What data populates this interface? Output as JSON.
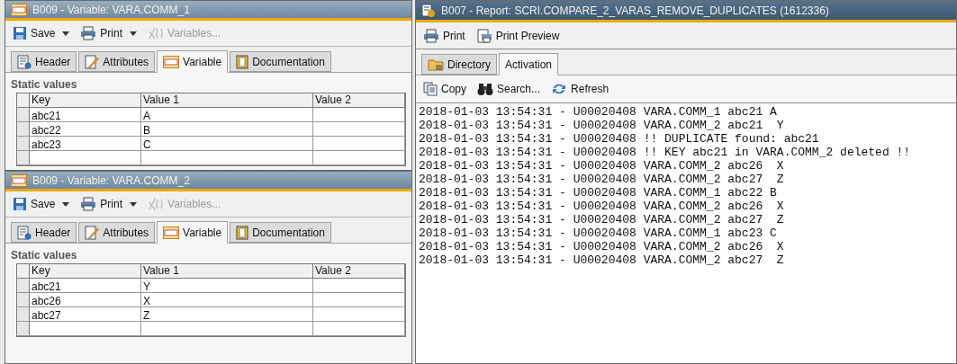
{
  "variable_windows": [
    {
      "title": "B009 - Variable: VARA.COMM_1",
      "toolbar": [
        {
          "label": "Save",
          "dropdown": true,
          "disabled": false
        },
        {
          "label": "Print",
          "dropdown": true,
          "disabled": false
        },
        {
          "label": "Variables...",
          "dropdown": false,
          "disabled": true
        }
      ],
      "tabs": [
        {
          "label": "Header",
          "selected": false
        },
        {
          "label": "Attributes",
          "selected": false
        },
        {
          "label": "Variable",
          "selected": true
        },
        {
          "label": "Documentation",
          "selected": false
        }
      ],
      "group_title": "Static values",
      "table": {
        "columns": [
          "Key",
          "Value 1",
          "Value 2"
        ],
        "rows": [
          [
            "abc21",
            "A"
          ],
          [
            "abc22",
            "B"
          ],
          [
            "abc23",
            "C"
          ]
        ]
      }
    },
    {
      "title": "B009 - Variable: VARA.COMM_2",
      "toolbar": [
        {
          "label": "Save",
          "dropdown": true,
          "disabled": false
        },
        {
          "label": "Print",
          "dropdown": true,
          "disabled": false
        },
        {
          "label": "Variables...",
          "dropdown": false,
          "disabled": true
        }
      ],
      "tabs": [
        {
          "label": "Header",
          "selected": false
        },
        {
          "label": "Attributes",
          "selected": false
        },
        {
          "label": "Variable",
          "selected": true
        },
        {
          "label": "Documentation",
          "selected": false
        }
      ],
      "group_title": "Static values",
      "table": {
        "columns": [
          "Key",
          "Value 1",
          "Value 2"
        ],
        "rows": [
          [
            "abc21",
            "Y"
          ],
          [
            "abc26",
            "X"
          ],
          [
            "abc27",
            "Z"
          ]
        ]
      }
    }
  ],
  "report_window": {
    "title": "B007 - Report: SCRI.COMPARE_2_VARAS_REMOVE_DUPLICATES (1612336)",
    "toolbar": [
      {
        "label": "Print"
      },
      {
        "label": "Print Preview"
      }
    ],
    "tabs": [
      {
        "label": "Directory",
        "selected": false
      },
      {
        "label": "Activation",
        "selected": true
      }
    ],
    "log_toolbar": [
      {
        "label": "Copy"
      },
      {
        "label": "Search..."
      },
      {
        "label": "Refresh"
      }
    ],
    "log_lines": [
      "2018-01-03 13:54:31 - U00020408 VARA.COMM_1 abc21 A",
      "2018-01-03 13:54:31 - U00020408 VARA.COMM_2 abc21  Y",
      "2018-01-03 13:54:31 - U00020408 !! DUPLICATE found: abc21",
      "2018-01-03 13:54:31 - U00020408 !! KEY abc21 in VARA.COMM_2 deleted !!",
      "2018-01-03 13:54:31 - U00020408 VARA.COMM_2 abc26  X",
      "2018-01-03 13:54:31 - U00020408 VARA.COMM_2 abc27  Z",
      "2018-01-03 13:54:31 - U00020408 VARA.COMM_1 abc22 B",
      "2018-01-03 13:54:31 - U00020408 VARA.COMM_2 abc26  X",
      "2018-01-03 13:54:31 - U00020408 VARA.COMM_2 abc27  Z",
      "2018-01-03 13:54:31 - U00020408 VARA.COMM_1 abc23 C",
      "2018-01-03 13:54:31 - U00020408 VARA.COMM_2 abc26  X",
      "2018-01-03 13:54:31 - U00020408 VARA.COMM_2 abc27  Z"
    ]
  }
}
